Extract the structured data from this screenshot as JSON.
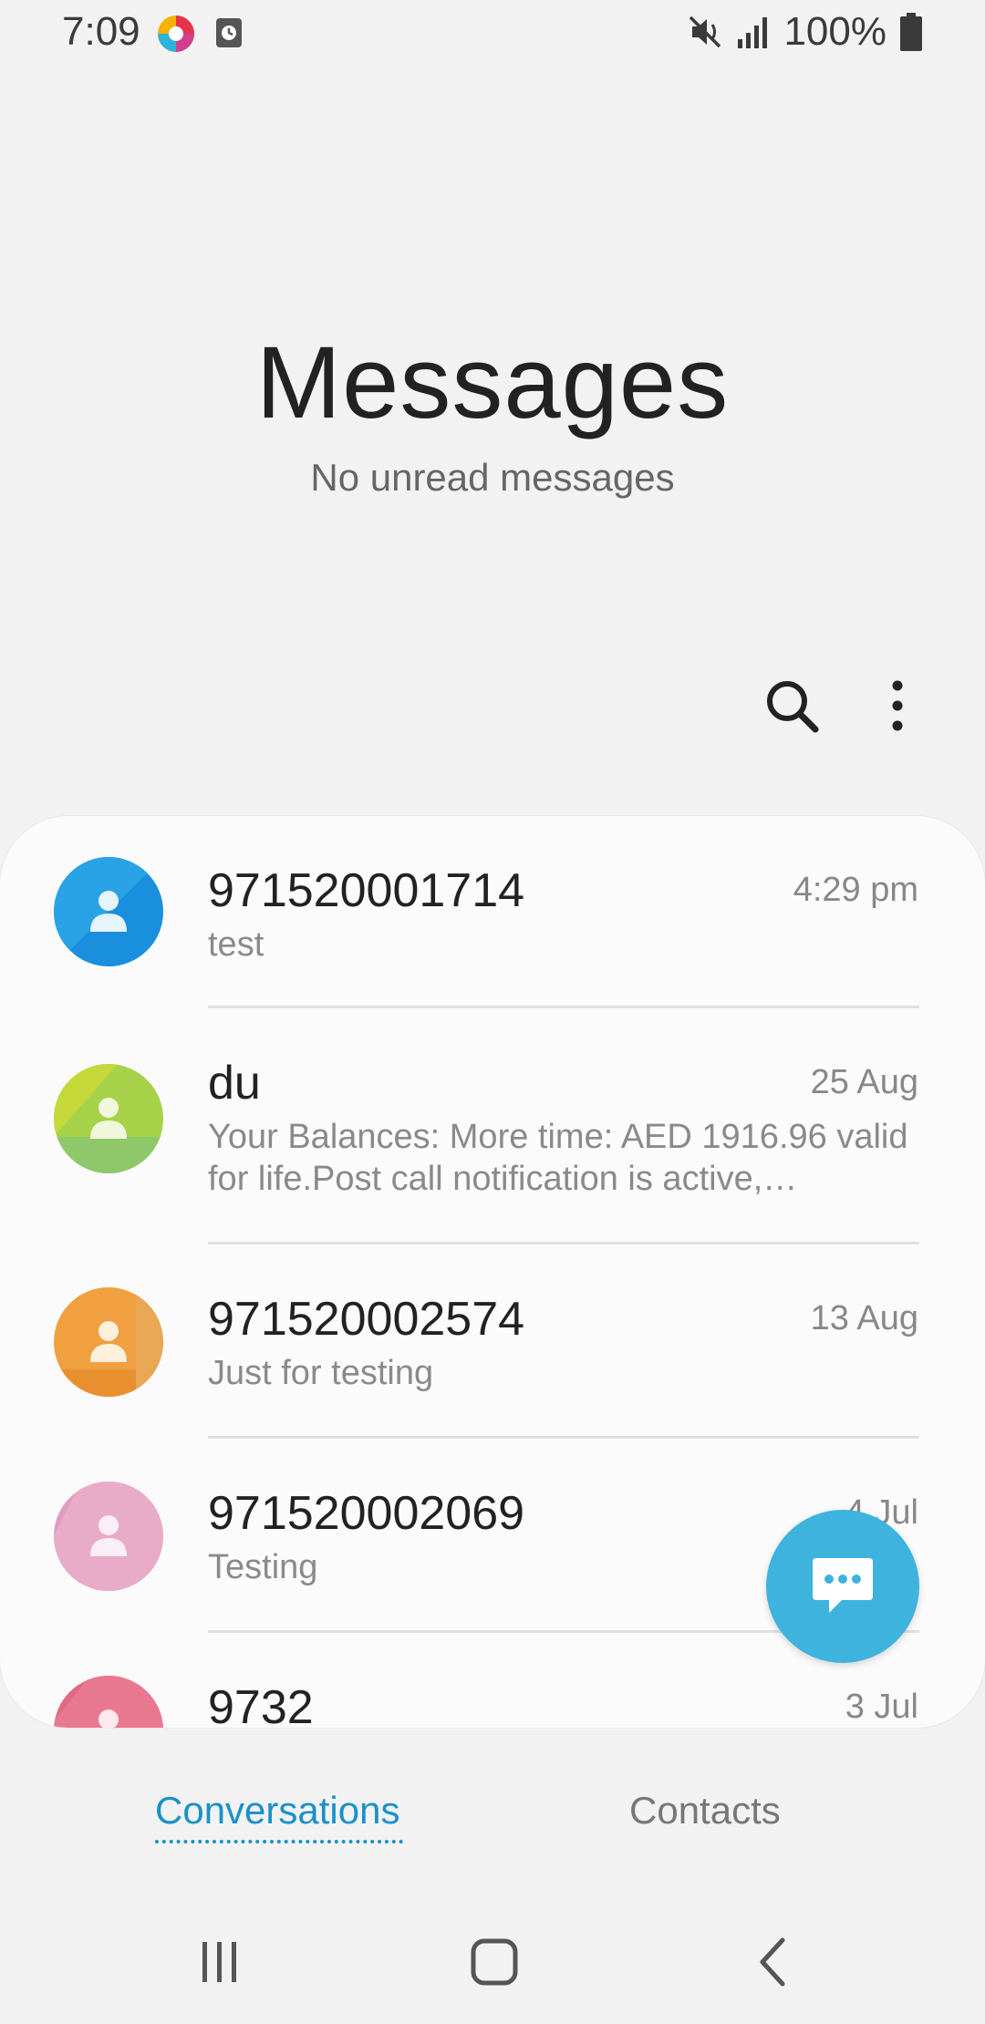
{
  "status_bar": {
    "time": "7:09",
    "battery": "100%",
    "icons": [
      "app-notification-icon",
      "clock-notification-icon",
      "mute-icon",
      "signal-icon",
      "battery-icon"
    ]
  },
  "header": {
    "title": "Messages",
    "subtitle": "No unread messages"
  },
  "toolbar": {
    "icons": [
      "search-icon",
      "more-options-icon"
    ]
  },
  "conversations": [
    {
      "name": "971520001714",
      "time": "4:29 pm",
      "preview": "test",
      "avatar_color": "#1a8fdd"
    },
    {
      "name": "du",
      "time": "25 Aug",
      "preview": "Your Balances: More time: AED 1916.96 valid for life.Post call notification is active,…",
      "avatar_color": "#a6d24a"
    },
    {
      "name": "971520002574",
      "time": "13 Aug",
      "preview": "Just for testing",
      "avatar_color": "#f0a040"
    },
    {
      "name": "971520002069",
      "time": "4 Jul",
      "preview": "Testing",
      "avatar_color": "#e29cc3"
    },
    {
      "name": "9732",
      "time": "3 Jul",
      "preview": "",
      "avatar_color": "#e46882"
    }
  ],
  "fab": {
    "icon": "compose-message-icon",
    "color": "#3db3de"
  },
  "tabs": {
    "conversations": "Conversations",
    "contacts": "Contacts",
    "active_color": "#1a91c9"
  },
  "nav_bar": {
    "icons": [
      "recent-apps-icon",
      "home-icon",
      "back-icon"
    ]
  }
}
